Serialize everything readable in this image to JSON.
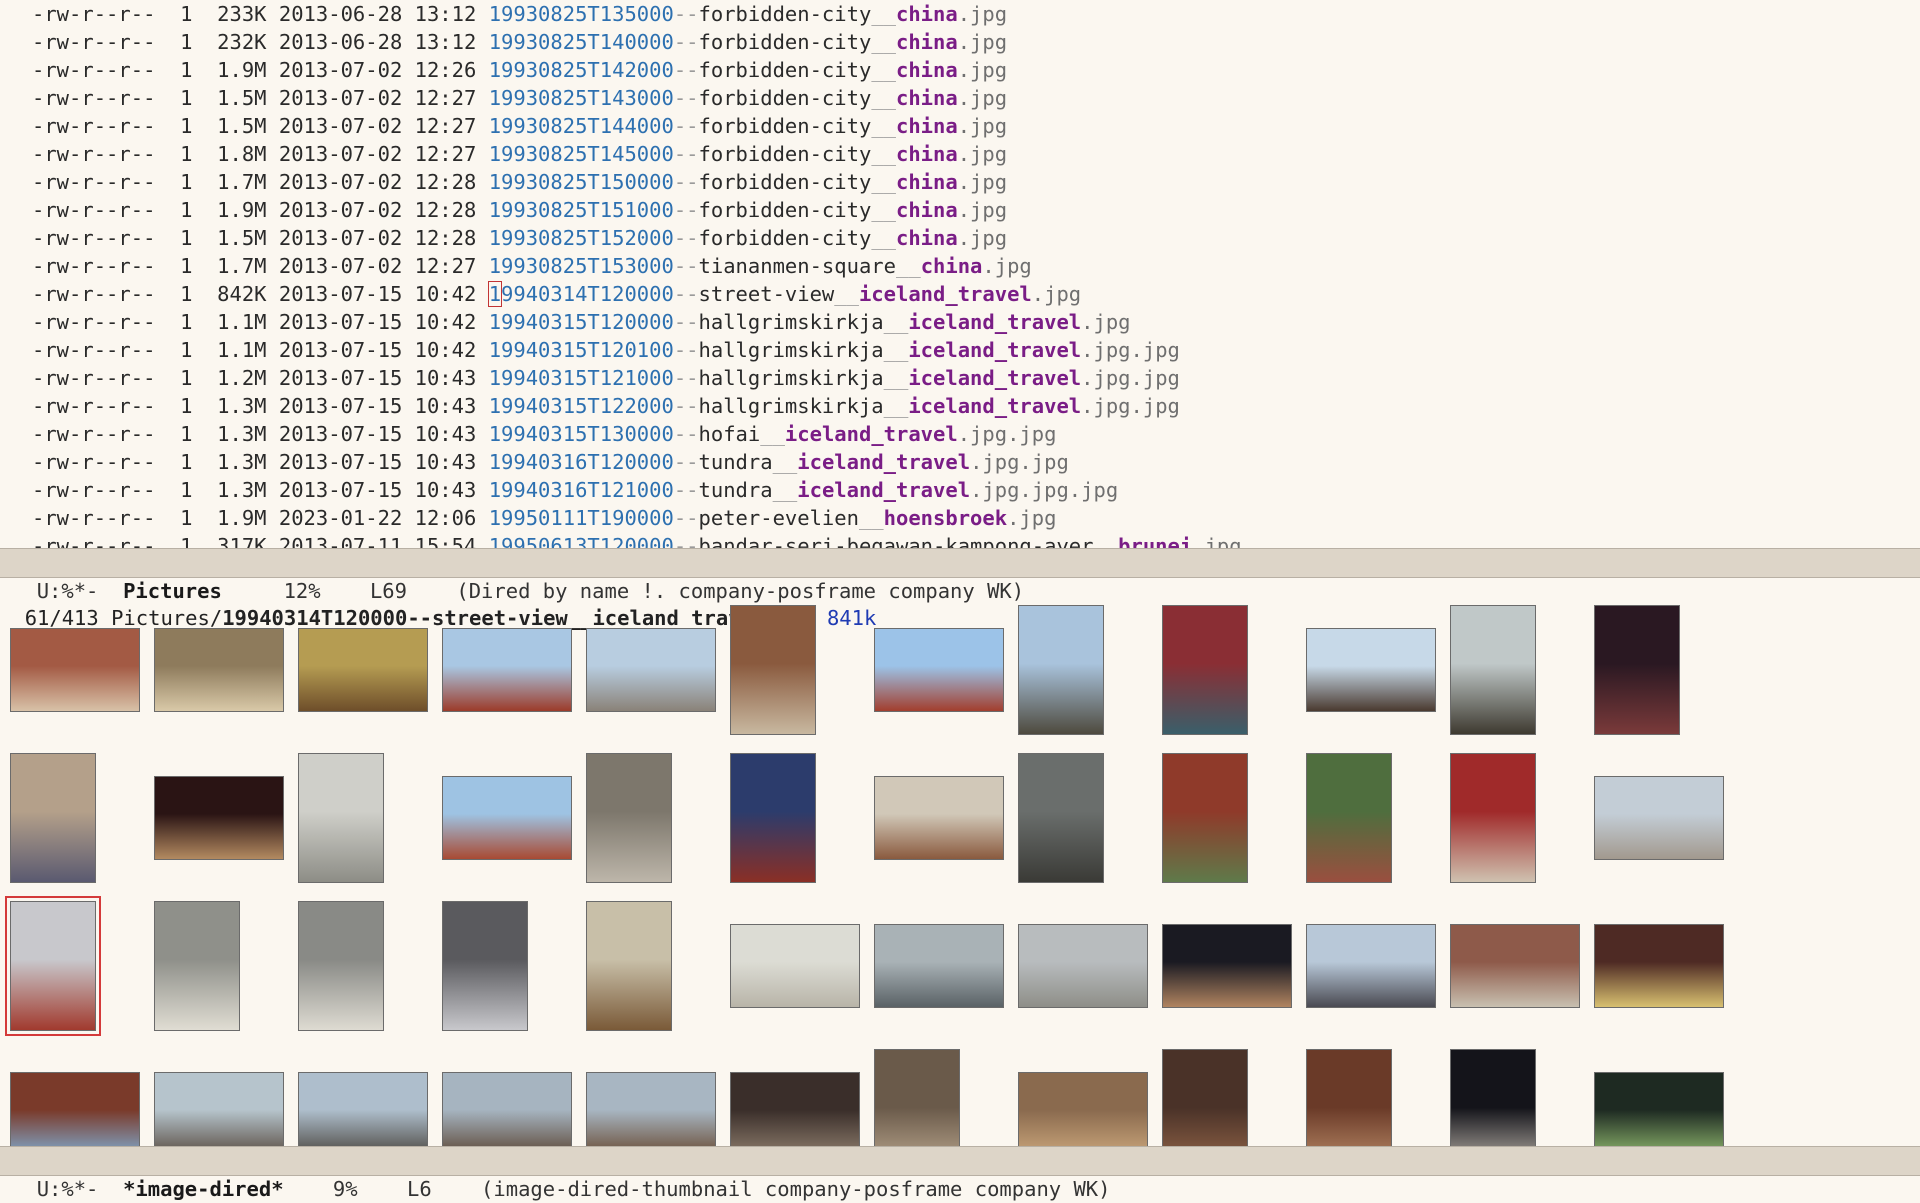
{
  "dired_lines": [
    {
      "perms": "-rw-r--r--",
      "links": "1",
      "size": "233K",
      "date": "2013-06-28 13:12",
      "ts": "19930825T135000",
      "name": "forbidden-city",
      "tag": "china",
      "ext": ".jpg"
    },
    {
      "perms": "-rw-r--r--",
      "links": "1",
      "size": "232K",
      "date": "2013-06-28 13:12",
      "ts": "19930825T140000",
      "name": "forbidden-city",
      "tag": "china",
      "ext": ".jpg"
    },
    {
      "perms": "-rw-r--r--",
      "links": "1",
      "size": "1.9M",
      "date": "2013-07-02 12:26",
      "ts": "19930825T142000",
      "name": "forbidden-city",
      "tag": "china",
      "ext": ".jpg"
    },
    {
      "perms": "-rw-r--r--",
      "links": "1",
      "size": "1.5M",
      "date": "2013-07-02 12:27",
      "ts": "19930825T143000",
      "name": "forbidden-city",
      "tag": "china",
      "ext": ".jpg"
    },
    {
      "perms": "-rw-r--r--",
      "links": "1",
      "size": "1.5M",
      "date": "2013-07-02 12:27",
      "ts": "19930825T144000",
      "name": "forbidden-city",
      "tag": "china",
      "ext": ".jpg"
    },
    {
      "perms": "-rw-r--r--",
      "links": "1",
      "size": "1.8M",
      "date": "2013-07-02 12:27",
      "ts": "19930825T145000",
      "name": "forbidden-city",
      "tag": "china",
      "ext": ".jpg"
    },
    {
      "perms": "-rw-r--r--",
      "links": "1",
      "size": "1.7M",
      "date": "2013-07-02 12:28",
      "ts": "19930825T150000",
      "name": "forbidden-city",
      "tag": "china",
      "ext": ".jpg"
    },
    {
      "perms": "-rw-r--r--",
      "links": "1",
      "size": "1.9M",
      "date": "2013-07-02 12:28",
      "ts": "19930825T151000",
      "name": "forbidden-city",
      "tag": "china",
      "ext": ".jpg"
    },
    {
      "perms": "-rw-r--r--",
      "links": "1",
      "size": "1.5M",
      "date": "2013-07-02 12:28",
      "ts": "19930825T152000",
      "name": "forbidden-city",
      "tag": "china",
      "ext": ".jpg"
    },
    {
      "perms": "-rw-r--r--",
      "links": "1",
      "size": "1.7M",
      "date": "2013-07-02 12:27",
      "ts": "19930825T153000",
      "name": "tiananmen-square",
      "tag": "china",
      "ext": ".jpg"
    },
    {
      "perms": "-rw-r--r--",
      "links": "1",
      "size": "842K",
      "date": "2013-07-15 10:42",
      "ts": "19940314T120000",
      "name": "street-view",
      "tag": "iceland_travel",
      "ext": ".jpg",
      "cursor": true
    },
    {
      "perms": "-rw-r--r--",
      "links": "1",
      "size": "1.1M",
      "date": "2013-07-15 10:42",
      "ts": "19940315T120000",
      "name": "hallgrimskirkja",
      "tag": "iceland_travel",
      "ext": ".jpg"
    },
    {
      "perms": "-rw-r--r--",
      "links": "1",
      "size": "1.1M",
      "date": "2013-07-15 10:42",
      "ts": "19940315T120100",
      "name": "hallgrimskirkja",
      "tag": "iceland_travel",
      "ext": ".jpg.jpg"
    },
    {
      "perms": "-rw-r--r--",
      "links": "1",
      "size": "1.2M",
      "date": "2013-07-15 10:43",
      "ts": "19940315T121000",
      "name": "hallgrimskirkja",
      "tag": "iceland_travel",
      "ext": ".jpg.jpg"
    },
    {
      "perms": "-rw-r--r--",
      "links": "1",
      "size": "1.3M",
      "date": "2013-07-15 10:43",
      "ts": "19940315T122000",
      "name": "hallgrimskirkja",
      "tag": "iceland_travel",
      "ext": ".jpg.jpg"
    },
    {
      "perms": "-rw-r--r--",
      "links": "1",
      "size": "1.3M",
      "date": "2013-07-15 10:43",
      "ts": "19940315T130000",
      "name": "hofai",
      "tag": "iceland_travel",
      "ext": ".jpg.jpg"
    },
    {
      "perms": "-rw-r--r--",
      "links": "1",
      "size": "1.3M",
      "date": "2013-07-15 10:43",
      "ts": "19940316T120000",
      "name": "tundra",
      "tag": "iceland_travel",
      "ext": ".jpg.jpg"
    },
    {
      "perms": "-rw-r--r--",
      "links": "1",
      "size": "1.3M",
      "date": "2013-07-15 10:43",
      "ts": "19940316T121000",
      "name": "tundra",
      "tag": "iceland_travel",
      "ext": ".jpg.jpg.jpg"
    },
    {
      "perms": "-rw-r--r--",
      "links": "1",
      "size": "1.9M",
      "date": "2023-01-22 12:06",
      "ts": "19950111T190000",
      "name": "peter-evelien",
      "tag": "hoensbroek",
      "ext": ".jpg"
    },
    {
      "perms": "-rw-r--r--",
      "links": "1",
      "size": "317K",
      "date": "2013-07-11 15:54",
      "ts": "19950613T120000",
      "name": "bandar-seri-begawan-kampong-ayer",
      "tag": "brunei",
      "ext": ".jpg"
    }
  ],
  "modeline_top": {
    "status": "U:%*-",
    "buffer": "Pictures",
    "percent": "12%",
    "line": "L69",
    "modes": "(Dired by name !. company-posframe company WK)"
  },
  "echo": {
    "counter": "61/413",
    "dir": "Pictures/",
    "file": "19940314T120000--street-view__iceland_travel.jpg",
    "size": "841k"
  },
  "modeline_bottom": {
    "status": "U:%*-",
    "buffer": "*image-dired*",
    "percent": "9%",
    "line": "L6",
    "modes": "(image-dired-thumbnail company-posframe company WK)"
  },
  "thumbnails": [
    {
      "row": 0,
      "col": 0,
      "orient": "land",
      "bg": "#a35a44",
      "fg": "#d8c2a8"
    },
    {
      "row": 0,
      "col": 1,
      "orient": "land",
      "bg": "#8e7b5c",
      "fg": "#d9c9a8"
    },
    {
      "row": 0,
      "col": 2,
      "orient": "land",
      "bg": "#b59c52",
      "fg": "#6e4e2a"
    },
    {
      "row": 0,
      "col": 3,
      "orient": "land",
      "bg": "#a9c7e3",
      "fg": "#9c3b2a"
    },
    {
      "row": 0,
      "col": 4,
      "orient": "land",
      "bg": "#b8cde0",
      "fg": "#8a8278"
    },
    {
      "row": 0,
      "col": 5,
      "orient": "port",
      "bg": "#8a5a3e",
      "fg": "#c8b8a0"
    },
    {
      "row": 0,
      "col": 6,
      "orient": "land",
      "bg": "#9cc3e8",
      "fg": "#a23e2e"
    },
    {
      "row": 0,
      "col": 7,
      "orient": "port",
      "bg": "#a9c3dc",
      "fg": "#4e4a3e"
    },
    {
      "row": 0,
      "col": 8,
      "orient": "port",
      "bg": "#8a2e34",
      "fg": "#3a5f6a"
    },
    {
      "row": 0,
      "col": 9,
      "orient": "land",
      "bg": "#c7d9e8",
      "fg": "#4a3a30"
    },
    {
      "row": 0,
      "col": 10,
      "orient": "port",
      "bg": "#c0c8c8",
      "fg": "#3e3a30"
    },
    {
      "row": 0,
      "col": 11,
      "orient": "port",
      "bg": "#2a1822",
      "fg": "#7a3a3a"
    },
    {
      "row": 1,
      "col": 0,
      "orient": "port",
      "bg": "#b4a08a",
      "fg": "#5a5a70"
    },
    {
      "row": 1,
      "col": 1,
      "orient": "land",
      "bg": "#2a1414",
      "fg": "#b38a60"
    },
    {
      "row": 1,
      "col": 2,
      "orient": "port",
      "bg": "#cfcfc9",
      "fg": "#8d8d86"
    },
    {
      "row": 1,
      "col": 3,
      "orient": "land",
      "bg": "#9ec3e3",
      "fg": "#a84a33"
    },
    {
      "row": 1,
      "col": 4,
      "orient": "port",
      "bg": "#7d776c",
      "fg": "#bdb6aa"
    },
    {
      "row": 1,
      "col": 5,
      "orient": "port",
      "bg": "#2c3c6c",
      "fg": "#8a2f26"
    },
    {
      "row": 1,
      "col": 6,
      "orient": "land",
      "bg": "#d1c8b8",
      "fg": "#8a5a3e"
    },
    {
      "row": 1,
      "col": 7,
      "orient": "port",
      "bg": "#6a6e6c",
      "fg": "#3a3a36"
    },
    {
      "row": 1,
      "col": 8,
      "orient": "port",
      "bg": "#8f3a2a",
      "fg": "#5f7a4a"
    },
    {
      "row": 1,
      "col": 9,
      "orient": "port",
      "bg": "#4f6e3e",
      "fg": "#9a4f3f"
    },
    {
      "row": 1,
      "col": 10,
      "orient": "port",
      "bg": "#a02a2a",
      "fg": "#cfc2b0"
    },
    {
      "row": 1,
      "col": 11,
      "orient": "land",
      "bg": "#c3cdd6",
      "fg": "#a2998e"
    },
    {
      "row": 2,
      "col": 0,
      "orient": "port",
      "bg": "#c8c8cc",
      "fg": "#a13a2e",
      "marked": true
    },
    {
      "row": 2,
      "col": 1,
      "orient": "port",
      "bg": "#8f908a",
      "fg": "#e0ddd3"
    },
    {
      "row": 2,
      "col": 2,
      "orient": "port",
      "bg": "#898a86",
      "fg": "#dedbd2"
    },
    {
      "row": 2,
      "col": 3,
      "orient": "port",
      "bg": "#5a5a5e",
      "fg": "#c8c8cc"
    },
    {
      "row": 2,
      "col": 4,
      "orient": "port",
      "bg": "#c8bfa8",
      "fg": "#7a5a38"
    },
    {
      "row": 2,
      "col": 5,
      "orient": "land",
      "bg": "#dcdcd4",
      "fg": "#b8b4a8"
    },
    {
      "row": 2,
      "col": 6,
      "orient": "land",
      "bg": "#a9b2b6",
      "fg": "#5a6266"
    },
    {
      "row": 2,
      "col": 7,
      "orient": "land",
      "bg": "#b8bcbe",
      "fg": "#8e8e88"
    },
    {
      "row": 2,
      "col": 8,
      "orient": "land",
      "bg": "#1a1a22",
      "fg": "#b08460"
    },
    {
      "row": 2,
      "col": 9,
      "orient": "land",
      "bg": "#b8c8d8",
      "fg": "#4a4a52"
    },
    {
      "row": 2,
      "col": 10,
      "orient": "land",
      "bg": "#8e5a4a",
      "fg": "#c8c0b0"
    },
    {
      "row": 2,
      "col": 11,
      "orient": "land",
      "bg": "#4e2a24",
      "fg": "#d8c070"
    },
    {
      "row": 3,
      "col": 0,
      "orient": "land",
      "bg": "#7a3a2a",
      "fg": "#7fa6c8"
    },
    {
      "row": 3,
      "col": 1,
      "orient": "land",
      "bg": "#b6c4cc",
      "fg": "#5a4e44"
    },
    {
      "row": 3,
      "col": 2,
      "orient": "land",
      "bg": "#aebecc",
      "fg": "#4e4a44"
    },
    {
      "row": 3,
      "col": 3,
      "orient": "land",
      "bg": "#a6b4c0",
      "fg": "#5e4a3a"
    },
    {
      "row": 3,
      "col": 4,
      "orient": "land",
      "bg": "#a8b6c2",
      "fg": "#6a4e38"
    },
    {
      "row": 3,
      "col": 5,
      "orient": "land",
      "bg": "#3a2e2a",
      "fg": "#8a7a6a"
    },
    {
      "row": 3,
      "col": 6,
      "orient": "port",
      "bg": "#6a5a4a",
      "fg": "#c8b49a"
    },
    {
      "row": 3,
      "col": 7,
      "orient": "land",
      "bg": "#8a6a4e",
      "fg": "#c8a47a"
    },
    {
      "row": 3,
      "col": 8,
      "orient": "port",
      "bg": "#4a3228",
      "fg": "#a06e4e"
    },
    {
      "row": 3,
      "col": 9,
      "orient": "port",
      "bg": "#6a3a28",
      "fg": "#c89a74"
    },
    {
      "row": 3,
      "col": 10,
      "orient": "port",
      "bg": "#14141a",
      "fg": "#d8d0c4"
    },
    {
      "row": 3,
      "col": 11,
      "orient": "land",
      "bg": "#1e2a22",
      "fg": "#8ab06a"
    }
  ]
}
